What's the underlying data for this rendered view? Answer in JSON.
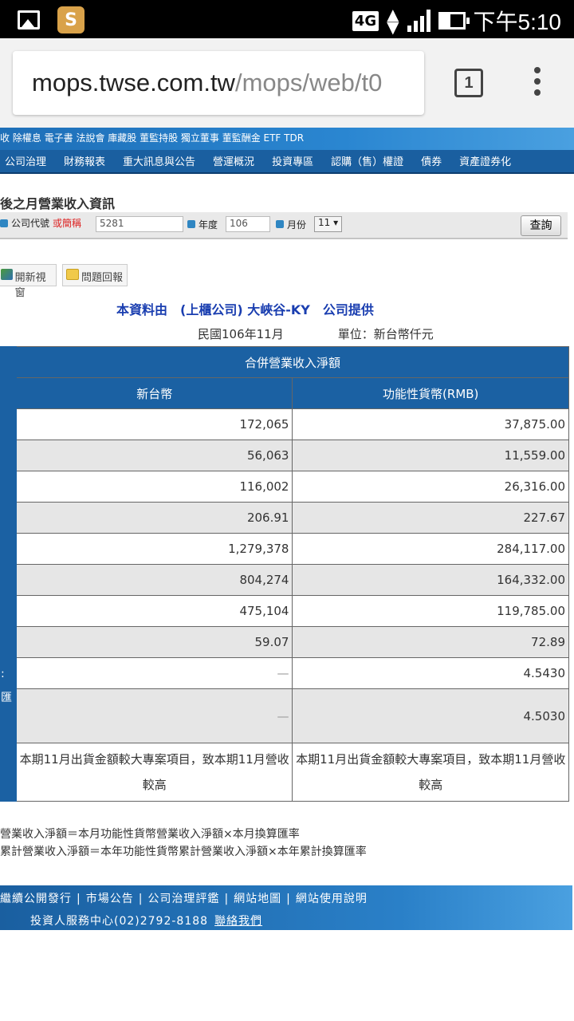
{
  "status_bar": {
    "network": "4G",
    "time": "下午5:10"
  },
  "browser": {
    "url_host": "mops.twse.com.tw",
    "url_path": "/mops/web/t0",
    "tab_count": "1"
  },
  "site": {
    "top_links": "收 除權息 電子書 法說會 庫藏股 董監持股 獨立董事 董監酬金 ETF TDR",
    "main_nav": [
      "公司治理",
      "財務報表",
      "重大訊息與公告",
      "營運概況",
      "投資專區",
      "認購（售）權證",
      "債券",
      "資產證券化"
    ],
    "page_title": "後之月營業收入資訊"
  },
  "search": {
    "company_label": "公司代號",
    "company_label_alt": "或簡稱",
    "company_value": "5281",
    "year_label": "年度",
    "year_value": "106",
    "month_label": "月份",
    "month_value": "11",
    "query_button": "查詢"
  },
  "tools": {
    "new_window": "開新視窗",
    "feedback": "問題回報"
  },
  "report": {
    "provider": "本資料由　(上櫃公司) 大峽谷-KY　公司提供",
    "period": "民國106年11月",
    "unit": "單位：新台幣仟元"
  },
  "table": {
    "group_header": "合併營業收入淨額",
    "col_twd": "新台幣",
    "col_rmb": "功能性貨幣(RMB)",
    "left_marks": [
      "",
      "",
      "",
      "",
      "",
      "",
      "",
      "",
      ":",
      "匯",
      ""
    ],
    "rows": [
      {
        "twd": "172,065",
        "rmb": "37,875.00"
      },
      {
        "twd": "56,063",
        "rmb": "11,559.00"
      },
      {
        "twd": "116,002",
        "rmb": "26,316.00"
      },
      {
        "twd": "206.91",
        "rmb": "227.67"
      },
      {
        "twd": "1,279,378",
        "rmb": "284,117.00"
      },
      {
        "twd": "804,274",
        "rmb": "164,332.00"
      },
      {
        "twd": "475,104",
        "rmb": "119,785.00"
      },
      {
        "twd": "59.07",
        "rmb": "72.89"
      },
      {
        "twd": "—",
        "rmb": "4.5430"
      },
      {
        "twd": "—",
        "rmb": "4.5030"
      }
    ],
    "note_twd": "本期11月出貨金額較大專案項目，致本期11月營收較高",
    "note_rmb": "本期11月出貨金額較大專案項目，致本期11月營收較高"
  },
  "formulas": [
    "營業收入淨額＝本月功能性貨幣營業收入淨額×本月換算匯率",
    "累計營業收入淨額＝本年功能性貨幣累計營業收入淨額×本年累計換算匯率"
  ],
  "footer": {
    "links": [
      "繼續公開發行",
      "市場公告",
      "公司治理評鑑",
      "網站地圖",
      "網站使用說明"
    ],
    "service": "投資人服務中心(02)2792-8188",
    "contact": "聯絡我們"
  }
}
